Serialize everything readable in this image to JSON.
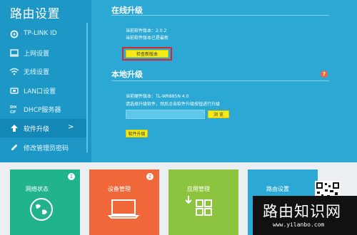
{
  "sidebar": {
    "title": "路由设置",
    "items": [
      {
        "label": "TP-LINK ID",
        "icon": "gear-icon"
      },
      {
        "label": "上网设置",
        "icon": "monitor-icon"
      },
      {
        "label": "无线设置",
        "icon": "wifi-icon"
      },
      {
        "label": "LAN口设置",
        "icon": "lan-port-icon"
      },
      {
        "label": "DHCP服务器",
        "icon": "dhcp-icon"
      },
      {
        "label": "软件升级",
        "icon": "upload-icon",
        "arrow": ">"
      },
      {
        "label": "修改管理员密码",
        "icon": "pencil-icon"
      }
    ]
  },
  "online_upgrade": {
    "title": "在线升级",
    "current_version": "当前软件版本：2.0.2",
    "status": "当前软件版本已是最新",
    "check_button": "检查新版本"
  },
  "local_upgrade": {
    "title": "本地升级",
    "hardware_version": "当前硬件版本：TL-WR885N 4.0",
    "instruction": "请选择升级软件，然后点击软件升级按钮进行升级",
    "browse_button": "浏 览",
    "upgrade_button": "软件升级",
    "help": "?"
  },
  "tiles": [
    {
      "title": "网络状态",
      "badge": "1",
      "color": "#21b38c",
      "icon": "globe-icon"
    },
    {
      "title": "设备管理",
      "badge": "2",
      "color": "#f0673a",
      "icon": "laptop-icon"
    },
    {
      "title": "应用管理",
      "color": "#8cc43f",
      "icon": "apps-grid-icon"
    },
    {
      "title": "路由设置",
      "color": "#2ba9d4",
      "icon": "router-icon"
    }
  ],
  "watermark": {
    "text": "路由知识网",
    "url": "www.yilanbo.com"
  }
}
